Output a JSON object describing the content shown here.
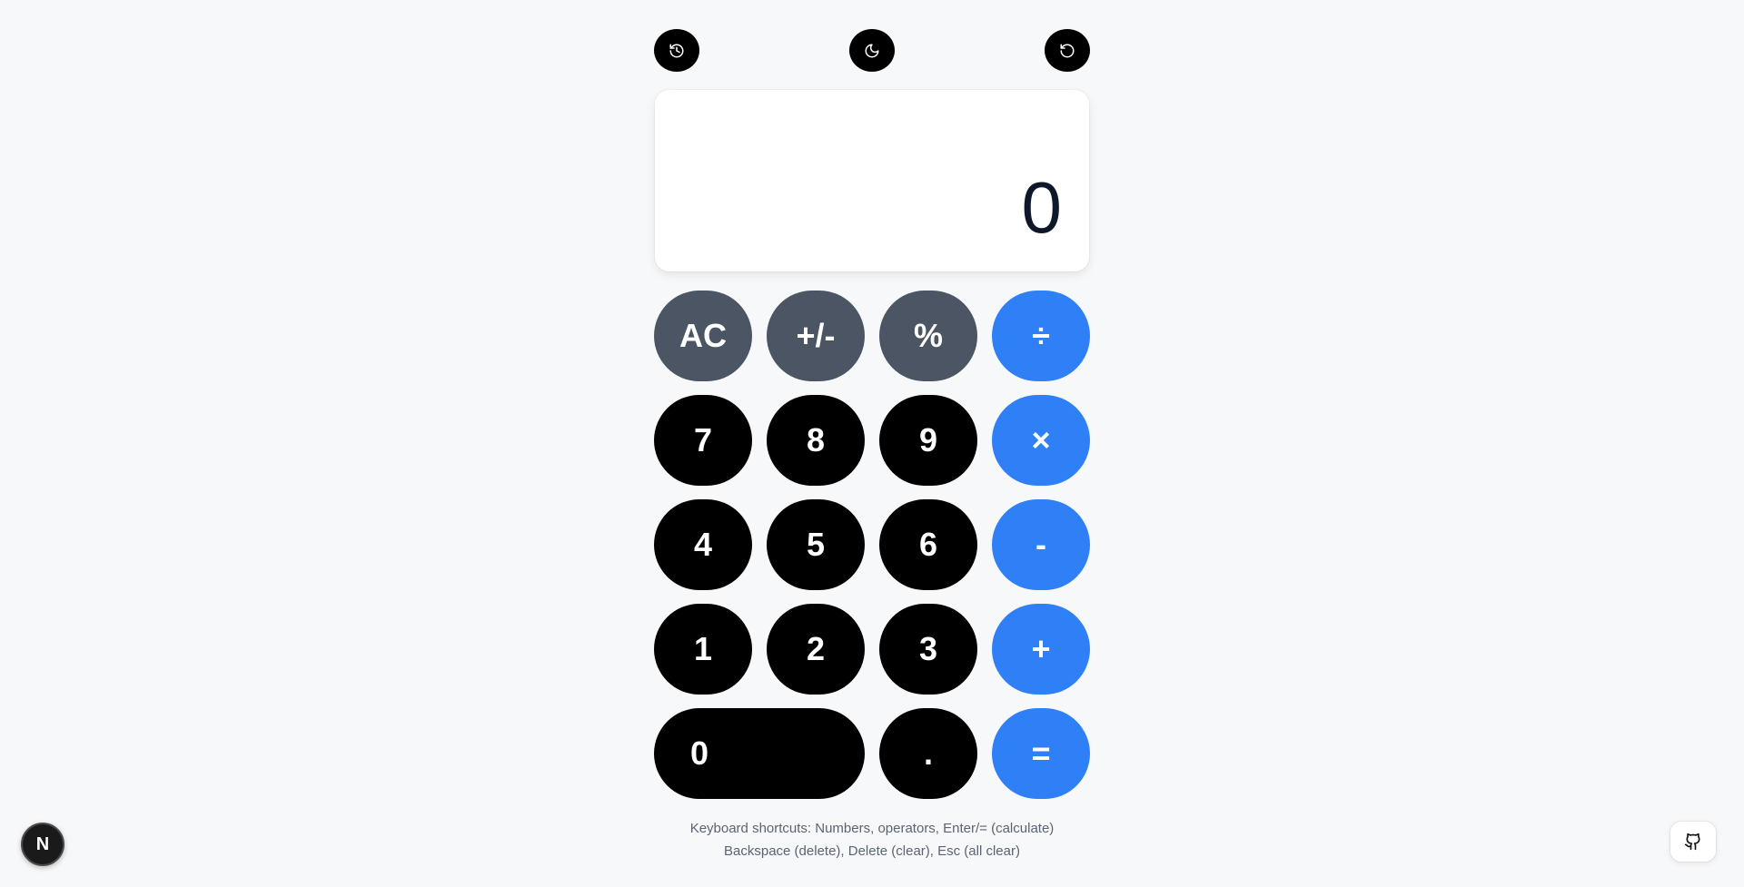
{
  "toolbar": {
    "history_icon": "history-icon",
    "theme_icon": "moon-icon",
    "reset_icon": "rotate-ccw-icon"
  },
  "display": {
    "value": "0"
  },
  "keys": {
    "row1": [
      "AC",
      "+/-",
      "%",
      "÷"
    ],
    "row2": [
      "7",
      "8",
      "9",
      "×"
    ],
    "row3": [
      "4",
      "5",
      "6",
      "-"
    ],
    "row4": [
      "1",
      "2",
      "3",
      "+"
    ],
    "row5": [
      "0",
      ".",
      "="
    ]
  },
  "footer": {
    "line1": "Keyboard shortcuts: Numbers, operators, Enter/= (calculate)",
    "line2": "Backspace (delete), Delete (clear), Esc (all clear)"
  },
  "badge": {
    "label": "N"
  },
  "colors": {
    "background": "#f7f8fa",
    "function_key": "#4b5563",
    "number_key": "#000000",
    "operator_key": "#2f80f7"
  }
}
